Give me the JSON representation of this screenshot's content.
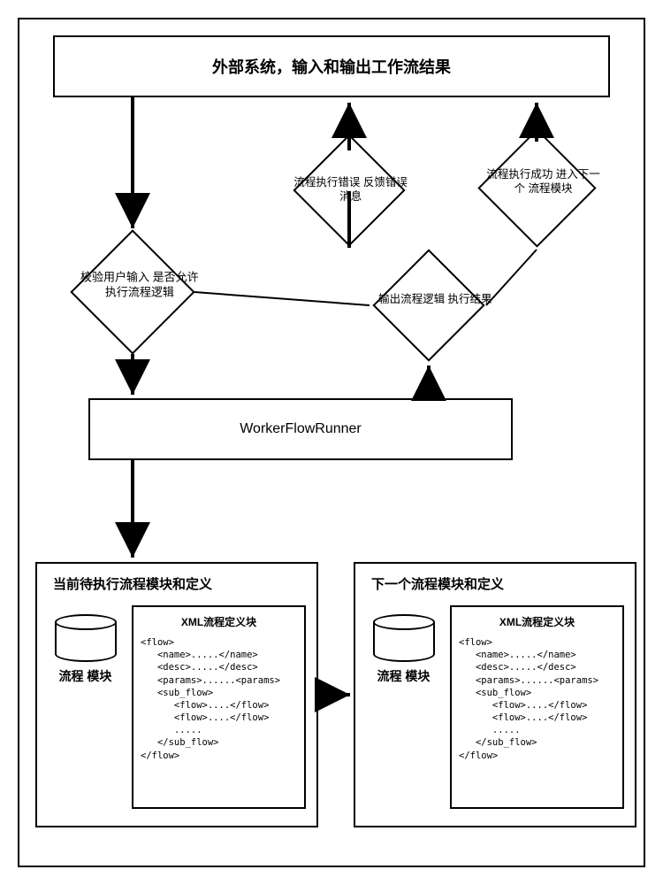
{
  "ext_system_title": "外部系统，输入和输出工作流结果",
  "diamonds": {
    "validate": "校验用户输入\n是否允许\n执行流程逻辑",
    "error": "流程执行错误\n反馈错误消息",
    "success": "流程执行成功\n进入下一个\n流程模块",
    "output": "输出流程逻辑\n执行结果"
  },
  "runner": "WorkerFlowRunner",
  "modules": {
    "current_title": "当前待执行流程模块和定义",
    "next_title": "下一个流程模块和定义",
    "db_label": "流程\n模块",
    "xml_title": "XML流程定义块",
    "xml_code": "<flow>\n   <name>.....</name>\n   <desc>.....</desc>\n   <params>......<params>\n   <sub_flow>\n      <flow>....</flow>\n      <flow>....</flow>\n      .....\n   </sub_flow>\n</flow>"
  }
}
